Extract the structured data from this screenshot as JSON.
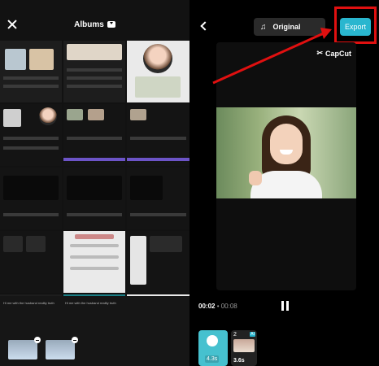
{
  "left": {
    "title": "Albums",
    "chat_snippet_1": "Hi me with the husband reality truth",
    "chat_snippet_2": "Hi me with the husband reality truth",
    "badge_count": "x2"
  },
  "right": {
    "audio_label": "Original",
    "export_label": "Export",
    "watermark": "CapCut",
    "time_current": "00:02",
    "time_separator": " • ",
    "time_total": "00:08",
    "clip1_duration": "4.3s",
    "clip2_number": "2",
    "clip2_duration": "3.6s",
    "clip2_badge": "AI"
  },
  "colors": {
    "accent": "#29b6cf",
    "highlight": "#e01010"
  }
}
